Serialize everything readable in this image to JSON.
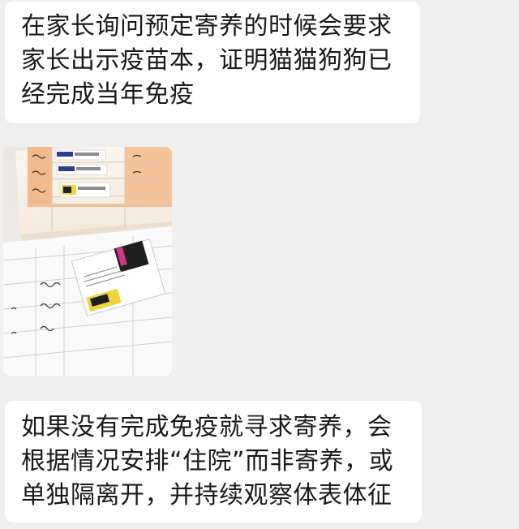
{
  "chat": {
    "messages": [
      {
        "type": "text",
        "lines": [
          "在家长询问预定寄养的时候会要求",
          "家长出示疫苗本，证明猫猫狗狗已",
          "经完成当年免疫"
        ]
      },
      {
        "type": "image",
        "subject": "vaccine-booklet-photo"
      },
      {
        "type": "text",
        "lines": [
          "如果没有完成免疫就寻求寄养，会",
          "根据情况安排“住院”而非寄养，或",
          "单独隔离开，并持续观察体表体征"
        ]
      }
    ]
  },
  "colors": {
    "background": "#efefef",
    "bubble": "#ffffff",
    "text": "#1a1a1a"
  }
}
